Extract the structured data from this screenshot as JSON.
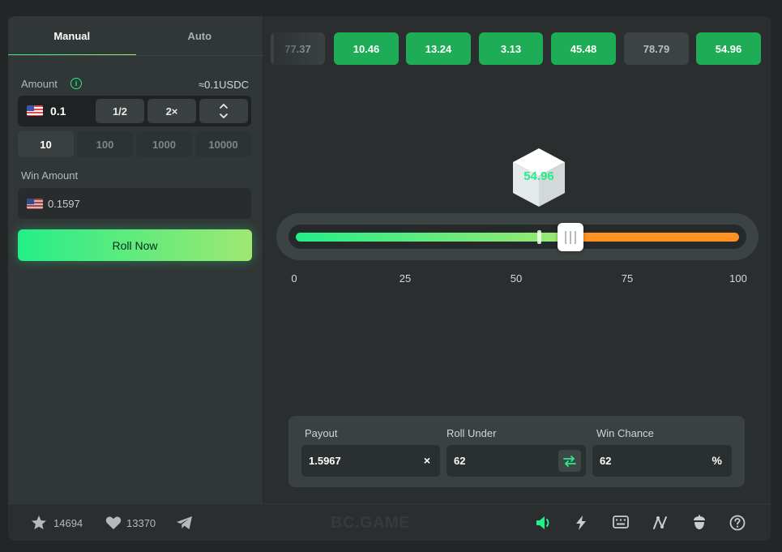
{
  "tabs": [
    "Manual",
    "Auto"
  ],
  "amount": {
    "label": "Amount",
    "info_icon": "i",
    "approx": "≈0.1USDC",
    "value": "0.1",
    "half_label": "1/2",
    "double_label": "2×"
  },
  "presets": [
    "10",
    "100",
    "1000",
    "10000"
  ],
  "win_amount": {
    "label": "Win Amount",
    "value": "0.1597"
  },
  "roll_button": "Roll Now",
  "history": [
    {
      "value": "77.37",
      "win": false
    },
    {
      "value": "10.46",
      "win": true
    },
    {
      "value": "13.24",
      "win": true
    },
    {
      "value": "3.13",
      "win": true
    },
    {
      "value": "45.48",
      "win": true
    },
    {
      "value": "78.79",
      "win": false
    },
    {
      "value": "54.96",
      "win": true
    }
  ],
  "result": "54.96",
  "slider": {
    "min": 0,
    "max": 100,
    "roll_under": 62,
    "result": 54.96,
    "ticks": [
      "0",
      "25",
      "50",
      "75",
      "100"
    ]
  },
  "stats": {
    "payout_label": "Payout",
    "payout_value": "1.5967",
    "payout_suffix": "×",
    "roll_under_label": "Roll Under",
    "roll_under_value": "62",
    "win_chance_label": "Win Chance",
    "win_chance_value": "62",
    "win_chance_suffix": "%"
  },
  "footer": {
    "favorites": "14694",
    "likes": "13370",
    "brand": "BC.GAME"
  },
  "colors": {
    "accent_green": "#24ee89",
    "accent_lime": "#9fe871",
    "orange": "#ff9221",
    "win_chip": "#1fac57",
    "panel": "#313636"
  },
  "icons": [
    "info-icon",
    "flag-icon",
    "chevron-up-down-icon",
    "swap-icon",
    "star-icon",
    "heart-icon",
    "telegram-icon",
    "sound-icon",
    "lightning-icon",
    "keyboard-icon",
    "chart-icon",
    "fairness-icon",
    "help-icon"
  ]
}
